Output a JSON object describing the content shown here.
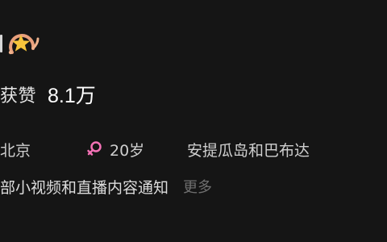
{
  "profile": {
    "likes_label": "获赞",
    "likes_value": "8.1万",
    "location": "北京",
    "age": "20岁",
    "place": "安提瓜岛和巴布达",
    "notice_text": "部小视频和直播内容通知",
    "more_label": "更多"
  },
  "icons": {
    "badge": "star-badge-icon",
    "gender": "female-icon"
  },
  "colors": {
    "background": "#151515",
    "primary_text": "#ffffff",
    "secondary_text": "#cfcfcf",
    "muted_text": "#6f6f6f",
    "female_accent": "#f472b6",
    "badge_star": "#f6c43b",
    "badge_ring": "#e9a07c"
  }
}
